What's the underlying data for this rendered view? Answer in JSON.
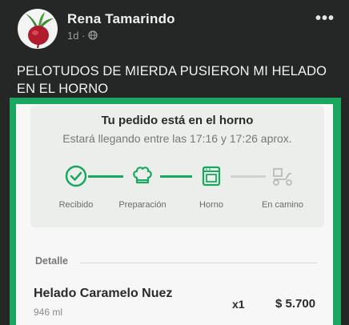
{
  "post": {
    "author": "Rena Tamarindo",
    "time": "1d",
    "separator": "·",
    "privacy_icon": "globe-icon",
    "more_icon": "more-dots-icon",
    "more_label": "•••",
    "caption": "PELOTUDOS DE MIERDA PUSIERON MI HELADO EN EL HORNO"
  },
  "order": {
    "title": "Tu pedido está en el horno",
    "subtitle": "Estará llegando entre las 17:16 y 17:26 aprox.",
    "steps": [
      {
        "label": "Recibido",
        "icon": "check-circle-icon",
        "done": true
      },
      {
        "label": "Preparación",
        "icon": "chef-hat-icon",
        "done": true
      },
      {
        "label": "Horno",
        "icon": "oven-icon",
        "done": true
      },
      {
        "label": "En camino",
        "icon": "delivery-scooter-icon",
        "done": false
      }
    ],
    "detail_label": "Detalle",
    "item": {
      "name": "Helado Caramelo Nuez",
      "size": "946 ml",
      "qty": "x1",
      "price": "$ 5.700"
    }
  },
  "colors": {
    "accent": "#1aa861",
    "pending": "#b8bdb9"
  }
}
